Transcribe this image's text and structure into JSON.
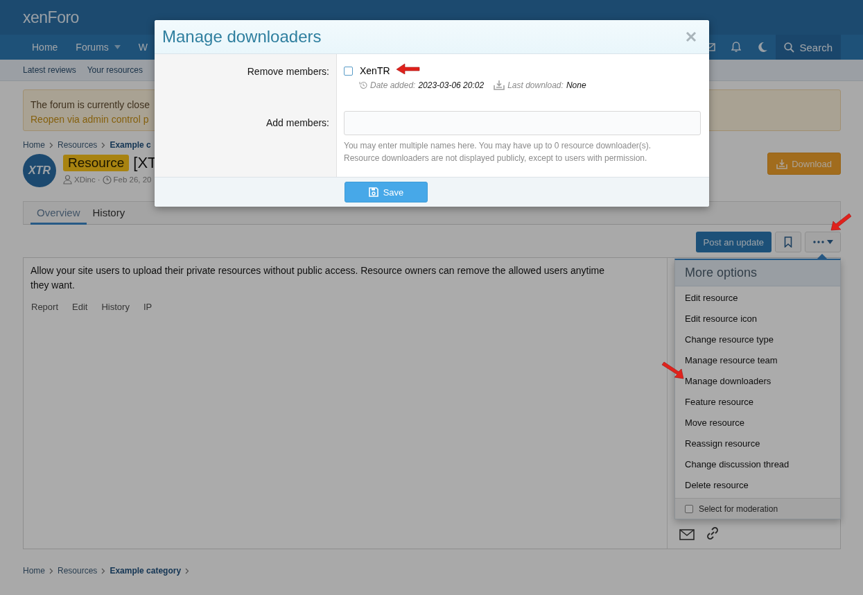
{
  "header": {
    "logo": "xenForo",
    "nav": [
      {
        "label": "Home",
        "dropdown": false
      },
      {
        "label": "Forums",
        "dropdown": true
      },
      {
        "label": "W",
        "dropdown": false
      }
    ],
    "search": "Search"
  },
  "subnav": [
    "Latest reviews",
    "Your resources"
  ],
  "notice": [
    "The forum is currently close",
    "Reopen via admin control p"
  ],
  "breadcrumb_top": [
    {
      "label": "Home",
      "current": false
    },
    {
      "label": "Resources",
      "current": false
    },
    {
      "label": "Example c",
      "current": true
    }
  ],
  "resource": {
    "avatar": "XTR",
    "prefix": "Resource",
    "title": "[XT",
    "author": "XDinc",
    "separator": "·",
    "date": "Feb 26, 20",
    "download": "Download"
  },
  "tabs": [
    {
      "label": "Overview",
      "selected": true
    },
    {
      "label": "History",
      "selected": false
    }
  ],
  "post_update": "Post an update",
  "description": "Allow your site users to upload their private resources without public access. Resource owners can remove the allowed users anytime they want.",
  "post_actions": [
    "Report",
    "Edit",
    "History",
    "IP"
  ],
  "menu": {
    "title": "More options",
    "items": [
      "Edit resource",
      "Edit resource icon",
      "Change resource type",
      "Manage resource team",
      "Manage downloaders",
      "Feature resource",
      "Move resource",
      "Reassign resource",
      "Change discussion thread",
      "Delete resource"
    ],
    "moderation": {
      "label": "Select for moderation",
      "checked": false
    }
  },
  "breadcrumb_bottom": [
    {
      "label": "Home",
      "current": false
    },
    {
      "label": "Resources",
      "current": false
    },
    {
      "label": "Example category",
      "current": true
    }
  ],
  "modal": {
    "title": "Manage downloaders",
    "remove_label": "Remove members:",
    "members": [
      {
        "name": "XenTR",
        "checked": false,
        "date_label": "Date added:",
        "date": "2023-03-06 20:02",
        "last_label": "Last download:",
        "last": "None"
      }
    ],
    "add_label": "Add members:",
    "hint": [
      "You may enter multiple names here. You may have up to 0 resource downloader(s).",
      "Resource downloaders are not displayed publicly, except to users with permission."
    ],
    "save": "Save"
  }
}
